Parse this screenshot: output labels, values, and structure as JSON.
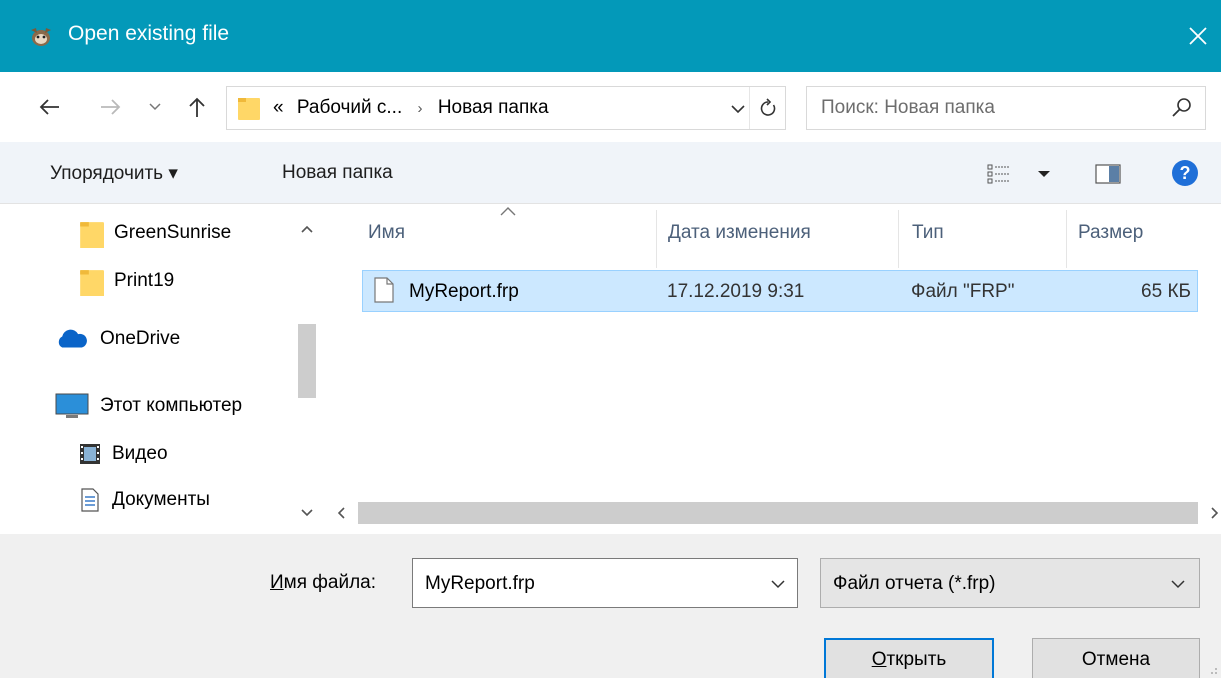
{
  "window": {
    "title": "Open existing file",
    "close_icon": "close-icon"
  },
  "navigation": {
    "back_icon": "arrow-left-icon",
    "forward_icon": "arrow-right-icon",
    "recent_icon": "chevron-down-icon",
    "up_icon": "arrow-up-icon"
  },
  "address": {
    "prefix": "«",
    "crumbs": [
      "Рабочий с...",
      "Новая папка"
    ],
    "separator": "›"
  },
  "search": {
    "placeholder": "Поиск: Новая папка"
  },
  "toolbar": {
    "organize_label": "Упорядочить ▾",
    "new_folder_label": "Новая папка",
    "help_label": "?"
  },
  "sidebar": {
    "items": [
      {
        "label": "GreenSunrise",
        "icon": "folder-icon"
      },
      {
        "label": "Print19",
        "icon": "folder-icon"
      },
      {
        "label": "OneDrive",
        "icon": "cloud-icon"
      },
      {
        "label": "Этот компьютер",
        "icon": "computer-icon"
      },
      {
        "label": "Видео",
        "icon": "video-icon"
      },
      {
        "label": "Документы",
        "icon": "documents-icon"
      }
    ]
  },
  "columns": {
    "name": "Имя",
    "date": "Дата изменения",
    "type": "Тип",
    "size": "Размер"
  },
  "files": [
    {
      "name": "MyReport.frp",
      "date": "17.12.2019 9:31",
      "type": "Файл \"FRP\"",
      "size": "65 КБ"
    }
  ],
  "bottom": {
    "filename_label_accel": "И",
    "filename_label_rest": "мя файла:",
    "filename_value": "MyReport.frp",
    "filetype_value": "Файл отчета (*.frp)",
    "open_accel": "О",
    "open_rest": "ткрыть",
    "cancel_label": "Отмена"
  },
  "colors": {
    "titlebar": "#0399b9",
    "selection": "#cce8ff",
    "accent": "#0078d7"
  }
}
